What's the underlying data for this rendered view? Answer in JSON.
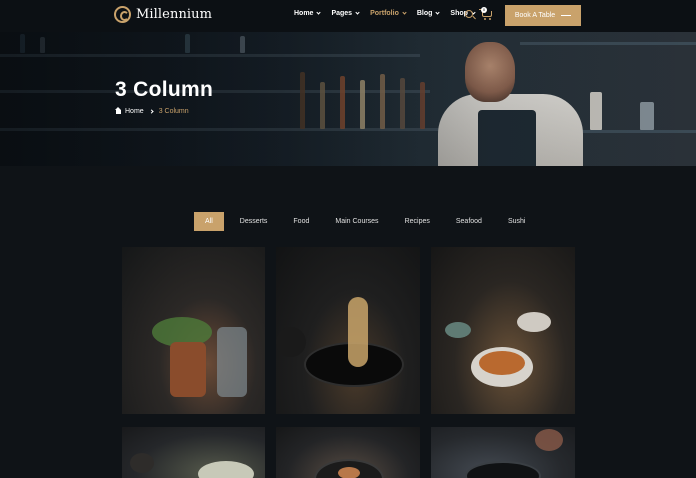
{
  "header": {
    "logo_text": "Millennium",
    "nav": [
      {
        "label": "Home"
      },
      {
        "label": "Pages"
      },
      {
        "label": "Portfolio"
      },
      {
        "label": "Blog"
      },
      {
        "label": "Shop"
      }
    ],
    "active_nav": "Portfolio",
    "cart_count": "0",
    "book_button": "Book A Table"
  },
  "hero": {
    "title": "3 Column",
    "breadcrumb": {
      "home": "Home",
      "current": "3 Column"
    }
  },
  "filters": [
    "All",
    "Desserts",
    "Food",
    "Main Courses",
    "Recipes",
    "Seafood",
    "Sushi"
  ],
  "active_filter": "All",
  "colors": {
    "accent": "#c9a26b",
    "background": "#0f1317",
    "header": "#0c1014"
  },
  "icons": [
    "logo-icon",
    "search-icon",
    "cart-icon",
    "home-icon"
  ]
}
